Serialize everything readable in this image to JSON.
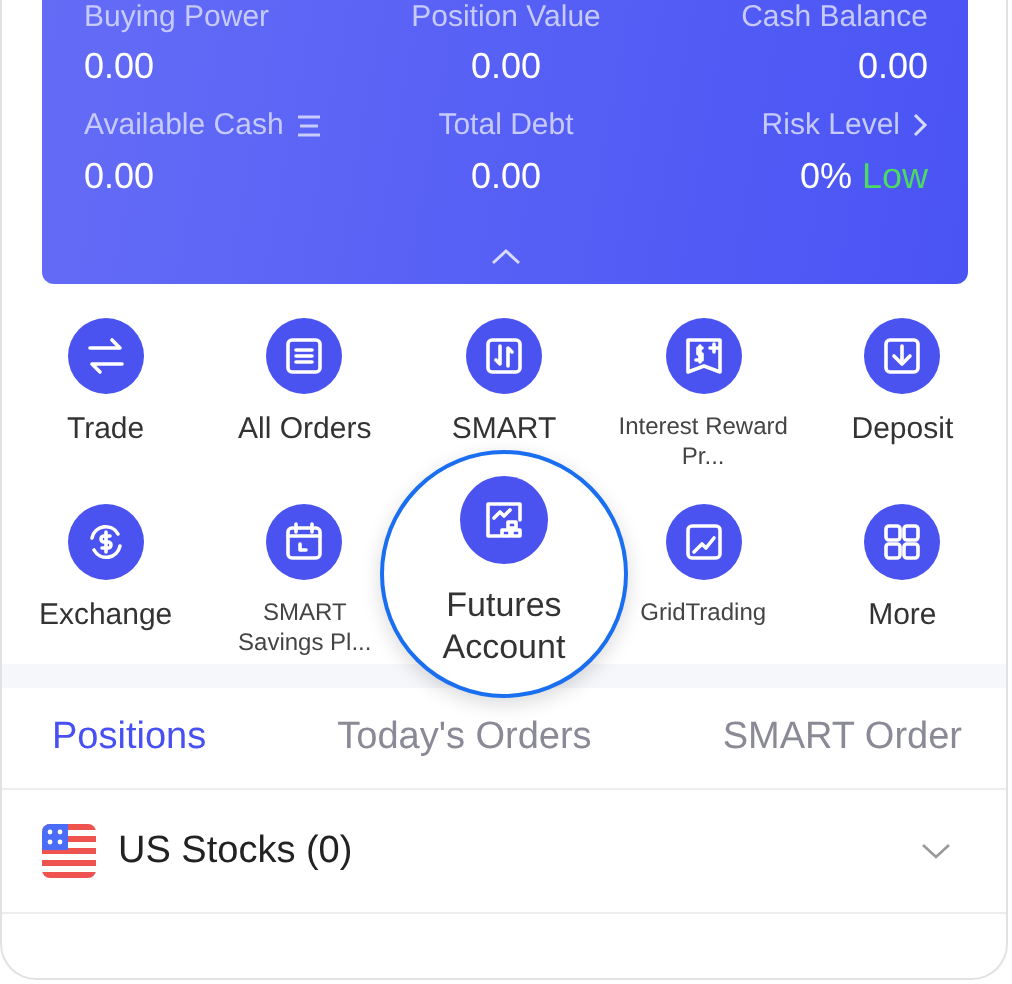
{
  "account_card": {
    "metrics": [
      {
        "label": "Buying Power",
        "value": "0.00"
      },
      {
        "label": "Position Value",
        "value": "0.00"
      },
      {
        "label": "Cash Balance",
        "value": "0.00"
      },
      {
        "label": "Available Cash",
        "value": "0.00"
      },
      {
        "label": "Total Debt",
        "value": "0.00"
      },
      {
        "label": "Risk Level",
        "value": "0%",
        "status": "Low"
      }
    ]
  },
  "shortcuts": [
    {
      "label": "Trade",
      "highlighted": false
    },
    {
      "label": "All Orders",
      "highlighted": false
    },
    {
      "label": "SMART",
      "highlighted": false
    },
    {
      "label": "Interest Reward Pr...",
      "highlighted": false
    },
    {
      "label": "Deposit",
      "highlighted": false
    },
    {
      "label": "Exchange",
      "highlighted": false
    },
    {
      "label": "SMART Savings Pl...",
      "highlighted": false
    },
    {
      "label": "Futures Account",
      "highlighted": true
    },
    {
      "label": "GridTrading",
      "highlighted": false
    },
    {
      "label": "More",
      "highlighted": false
    }
  ],
  "tabs": [
    {
      "label": "Positions",
      "selected": true
    },
    {
      "label": "Today's Orders",
      "selected": false
    },
    {
      "label": "SMART Order",
      "selected": false
    }
  ],
  "market_row": {
    "label": "US Stocks (0)",
    "expanded": false
  }
}
